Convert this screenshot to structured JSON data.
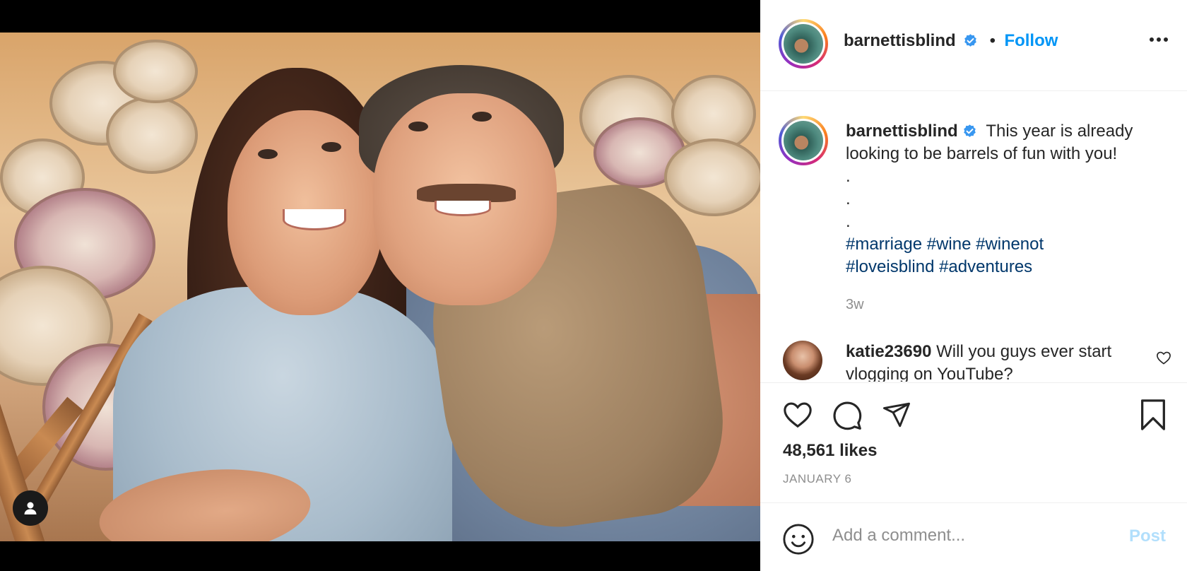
{
  "post": {
    "username": "barnettisblind",
    "verified": true,
    "follow_label": "Follow",
    "caption": "This year is already looking to be barrels of fun with you!",
    "caption_dots": [
      ".",
      ".",
      "."
    ],
    "hashtags_line1": "#marriage #wine #winenot",
    "hashtags_line2": "#loveisblind #adventures",
    "caption_age": "3w",
    "likes": "48,561 likes",
    "date": "JANUARY 6"
  },
  "comments": [
    {
      "username": "katie23690",
      "text": "Will you guys ever start vlogging on YouTube?"
    }
  ],
  "composer": {
    "placeholder": "Add a comment...",
    "post_label": "Post"
  },
  "icons": {
    "more": "more-options-icon",
    "like": "heart-icon",
    "comment": "comment-icon",
    "share": "share-icon",
    "save": "bookmark-icon",
    "emoji": "emoji-icon",
    "user_tag": "user-tag-icon",
    "verified": "verified-badge-icon"
  },
  "colors": {
    "accent": "#0095f6",
    "hashtag": "#00376b",
    "muted": "#8e8e8e",
    "post_disabled": "#b2dffc",
    "verified": "#3897f0"
  }
}
